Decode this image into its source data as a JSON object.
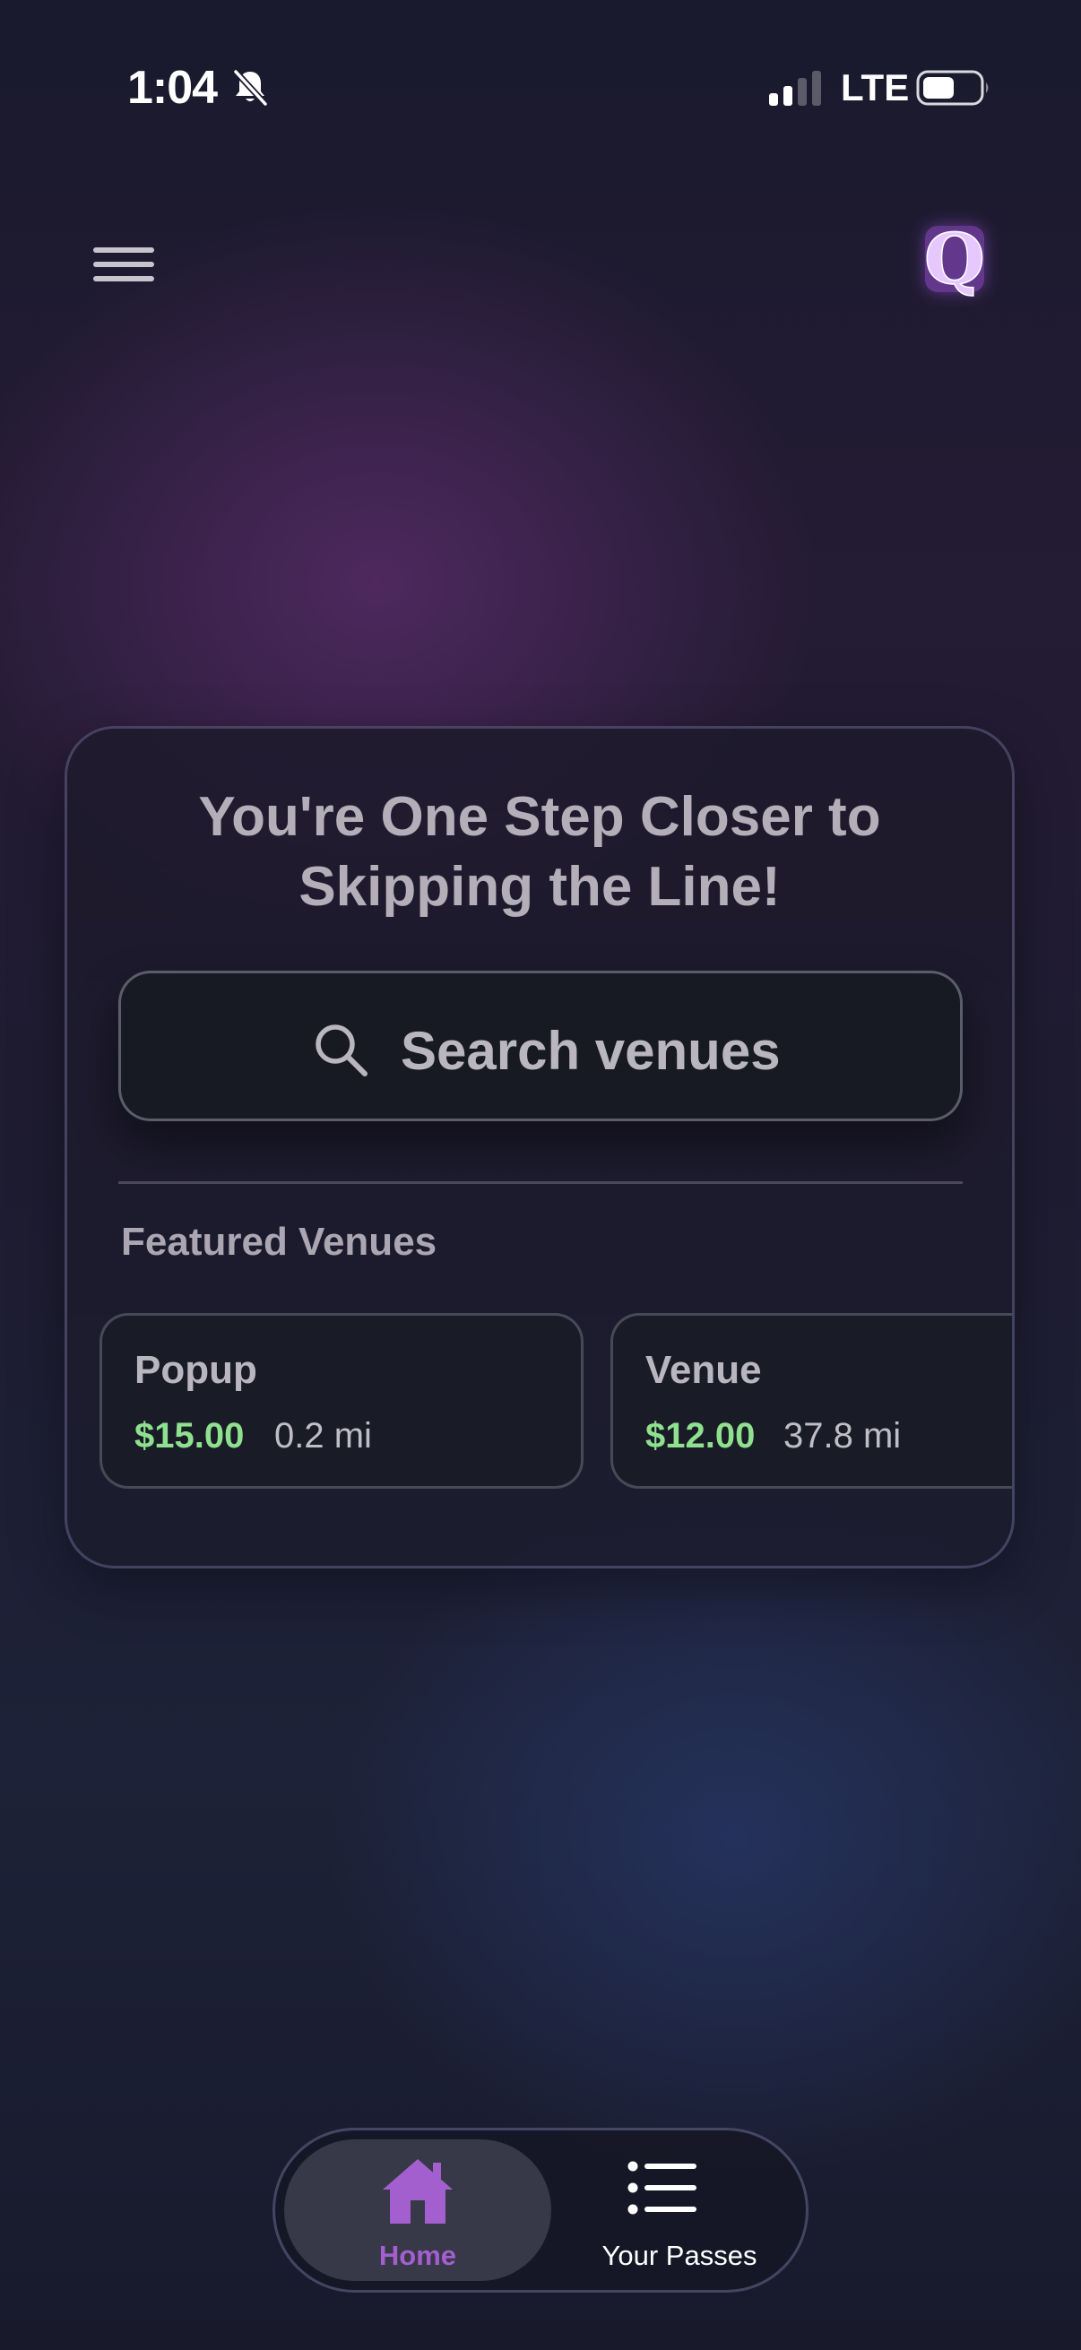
{
  "status_bar": {
    "time": "1:04",
    "network": "LTE",
    "icons": [
      "bell-slash-icon",
      "signal-icon",
      "battery-icon"
    ]
  },
  "top_bar": {
    "menu_icon": "hamburger-menu-icon",
    "logo_text": "Q",
    "logo_color": "#c27ff0"
  },
  "main": {
    "headline_line1": "You're One Step Closer to",
    "headline_line2": "Skipping the Line!",
    "search": {
      "icon": "search-icon",
      "label": "Search venues"
    },
    "featured_title": "Featured Venues",
    "venues": [
      {
        "name": "Popup",
        "price": "$15.00",
        "distance": "0.2 mi"
      },
      {
        "name": "Venue",
        "price": "$12.00",
        "distance": "37.8 mi"
      }
    ]
  },
  "bottom_nav": {
    "items": [
      {
        "label": "Home",
        "icon": "home-icon",
        "active": true
      },
      {
        "label": "Your Passes",
        "icon": "list-icon",
        "active": false
      }
    ]
  },
  "colors": {
    "accent_purple": "#a45fcf",
    "price_green": "#8fe08f",
    "background": "#1a1b2e"
  }
}
